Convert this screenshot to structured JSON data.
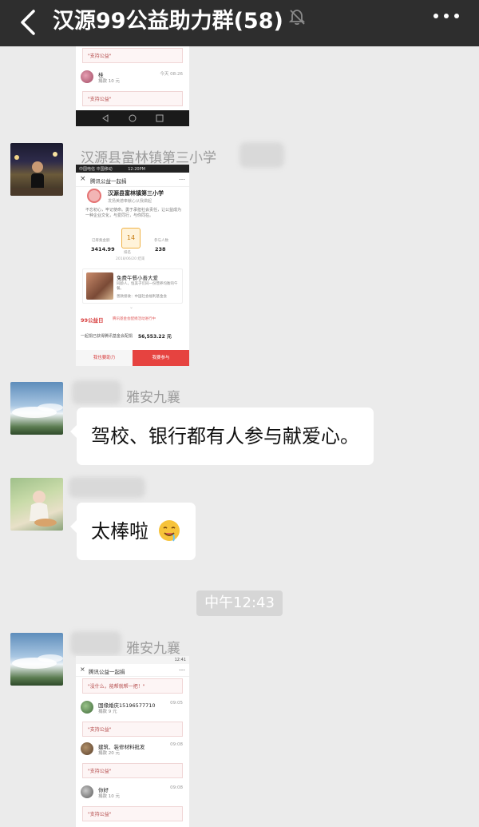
{
  "header": {
    "title": "汉源99公益助力群(58)",
    "back_icon": "chevron-left-icon",
    "mute_icon": "bell-muted-icon",
    "more_icon": "more-dots-icon"
  },
  "shot1": {
    "quote_top": "\"支持公益\"",
    "donor_name": "桂",
    "donor_time": "今天 08:26",
    "donor_amount": "捐款 10 元",
    "quote_bottom": "\"支持公益\""
  },
  "msg1": {
    "sender": "汉源县富林镇第三小学",
    "shot": {
      "status_left": "中国电信  中国移动",
      "status_time": "12:20PM",
      "nav_title": "腾讯公益一起捐",
      "org_name": "汉源县富林镇第三小学",
      "org_sub": "发扬美德奉献心从我做起",
      "intro": "不忘初心，牢记使命。勇于承担社会责任，让公益成为一种企业文化，与爱同行，与你同在。",
      "stat_left_value": "3414.99",
      "stat_left_label": "已筹集金额",
      "rank_value": "14",
      "rank_label": "排名",
      "stat_right_value": "238",
      "stat_right_label": "参与人数",
      "date_note": "2018/06/20 结束",
      "project_title": "免费午餐小善大爱",
      "project_desc": "同龄人，恒美子们同一份营养均衡的午餐。",
      "project_org": "善款接收：中国社会福利基金会",
      "brand": "99公益日",
      "brand_note": "腾讯基金会配捐活动进行中",
      "total_text": "一起捐已获得腾讯基金会配捐",
      "total_value": "56,553.22 元",
      "btn_left": "我也要助力",
      "btn_right": "我要参与"
    }
  },
  "msg2": {
    "sender": "雅安九襄",
    "text": "驾校、银行都有人参与献爱心。"
  },
  "msg3": {
    "text": "太棒啦"
  },
  "time_divider": "中午12:43",
  "msg4": {
    "sender": "雅安九襄",
    "shot": {
      "status_time": "12:41",
      "nav_title": "腾讯公益一起捐",
      "quote_0": "\"没什么，能帮就帮一把！\"",
      "donors": [
        {
          "name": "国缘婚庆15196577710",
          "amount": "捐款 9 元",
          "time": "09:05",
          "quote": "\"支持公益\""
        },
        {
          "name": "建筑、装修材料批发",
          "amount": "捐款 20 元",
          "time": "09:08",
          "quote": "\"支持公益\""
        },
        {
          "name": "你好",
          "amount": "捐款 10 元",
          "time": "09:08",
          "quote": "\"支持公益\""
        }
      ]
    }
  }
}
